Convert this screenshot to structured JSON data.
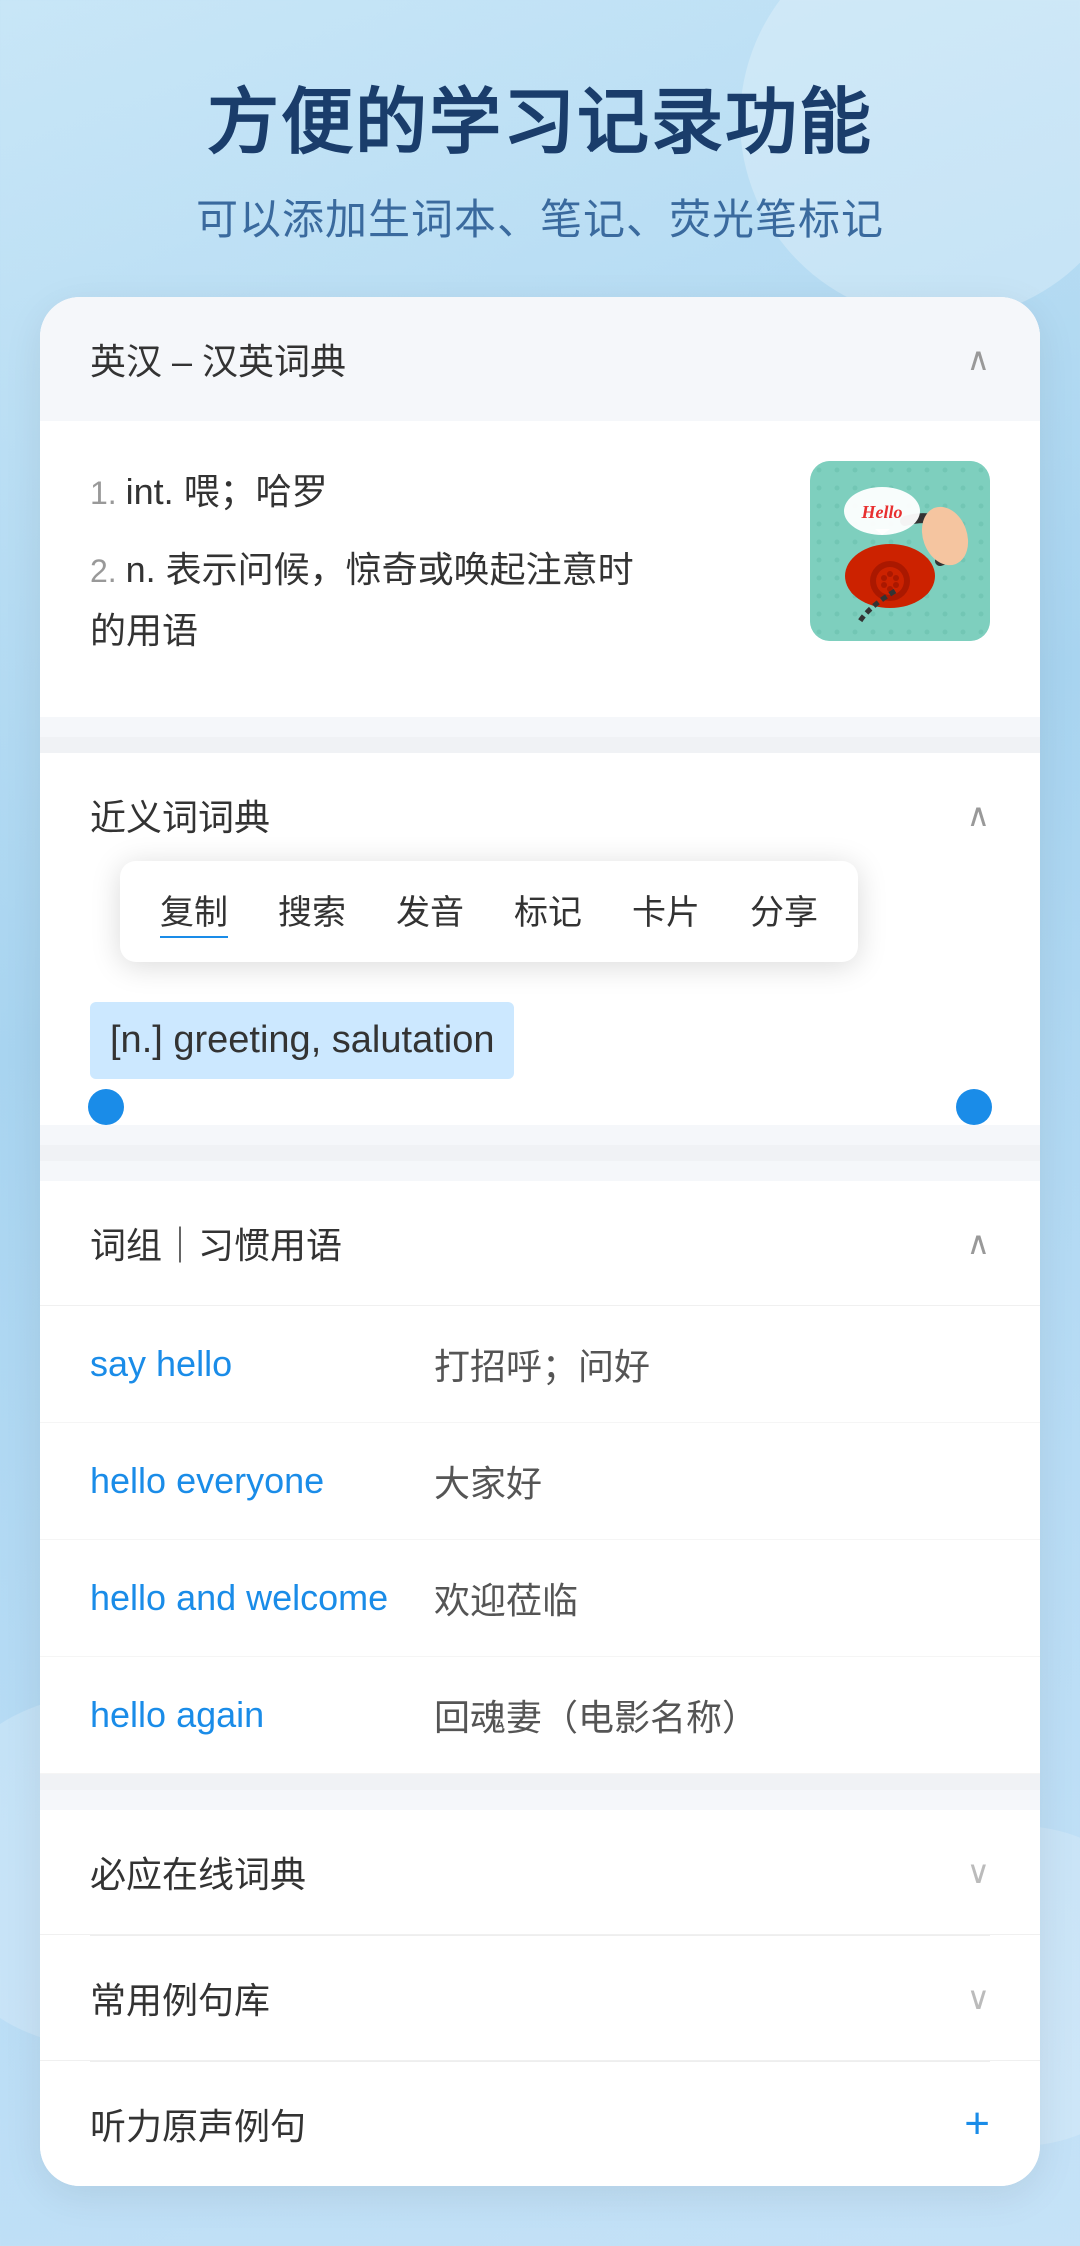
{
  "header": {
    "main_title": "方便的学习记录功能",
    "sub_title": "可以添加生词本、笔记、荧光笔标记"
  },
  "dict_section": {
    "title": "英汉 – 汉英词典",
    "chevron": "∧",
    "definitions": [
      {
        "num": "1.",
        "type": "int.",
        "text": "喂；哈罗"
      },
      {
        "num": "2.",
        "type": "n.",
        "text": "表示问候，惊奇或唤起注意时的用语"
      }
    ]
  },
  "synonym_section": {
    "title": "近义词词典",
    "chevron": "∧",
    "context_menu": {
      "items": [
        "复制",
        "搜索",
        "发音",
        "标记",
        "卡片",
        "分享"
      ]
    },
    "selected_text": "[n.] greeting, salutation"
  },
  "phrases_section": {
    "title": "词组｜习惯用语",
    "chevron": "∧",
    "phrases": [
      {
        "en": "say hello",
        "cn": "打招呼；问好"
      },
      {
        "en": "hello everyone",
        "cn": "大家好"
      },
      {
        "en": "hello and welcome",
        "cn": "欢迎莅临"
      },
      {
        "en": "hello again",
        "cn": "回魂妻（电影名称）"
      }
    ]
  },
  "bottom_sections": [
    {
      "title": "必应在线词典",
      "icon": "chevron-down"
    },
    {
      "title": "常用例句库",
      "icon": "chevron-down"
    },
    {
      "title": "听力原声例句",
      "icon": "plus"
    }
  ]
}
